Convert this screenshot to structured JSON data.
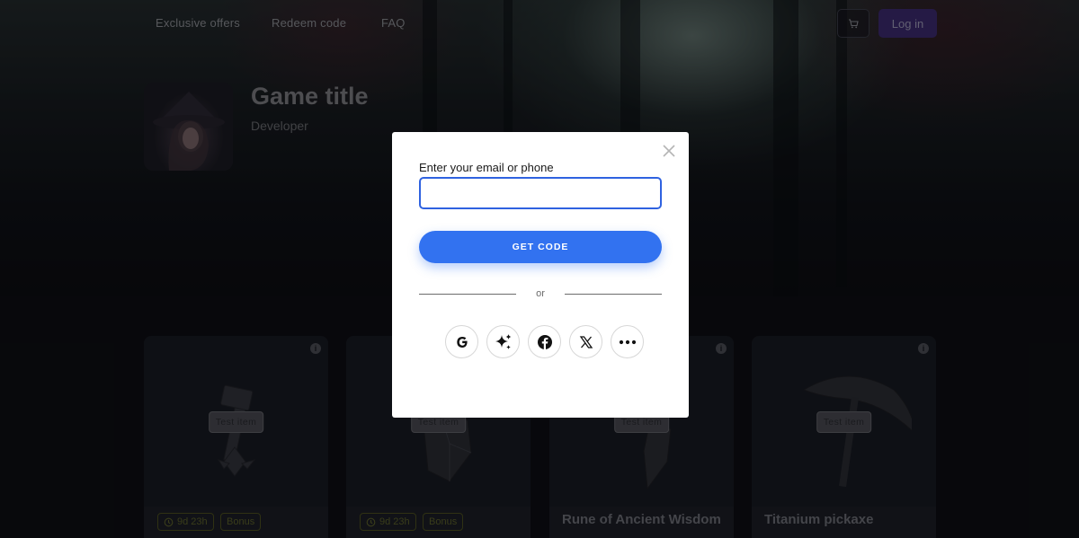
{
  "nav": {
    "links": [
      "Exclusive offers",
      "Redeem code",
      "FAQ"
    ],
    "login_label": "Log in"
  },
  "game": {
    "title": "Game title",
    "developer": "Developer"
  },
  "cards": [
    {
      "badge": "Test item",
      "timer": "9d 23h",
      "tag": "Bonus",
      "name": ""
    },
    {
      "badge": "Test item",
      "timer": "9d 23h",
      "tag": "Bonus",
      "name": ""
    },
    {
      "badge": "Test item",
      "timer": "",
      "tag": "",
      "name": "Rune of Ancient Wisdom"
    },
    {
      "badge": "Test item",
      "timer": "",
      "tag": "",
      "name": "Titanium pickaxe"
    }
  ],
  "modal": {
    "label": "Enter your email or phone",
    "input_value": "",
    "button_label": "GET CODE",
    "divider_text": "or",
    "social_icons": [
      "google-icon",
      "sparkle-icon",
      "facebook-icon",
      "x-icon",
      "more-icon"
    ]
  },
  "colors": {
    "primary_button": "#3272f0",
    "input_border": "#2f62e0",
    "login_button": "#3c2a70"
  }
}
